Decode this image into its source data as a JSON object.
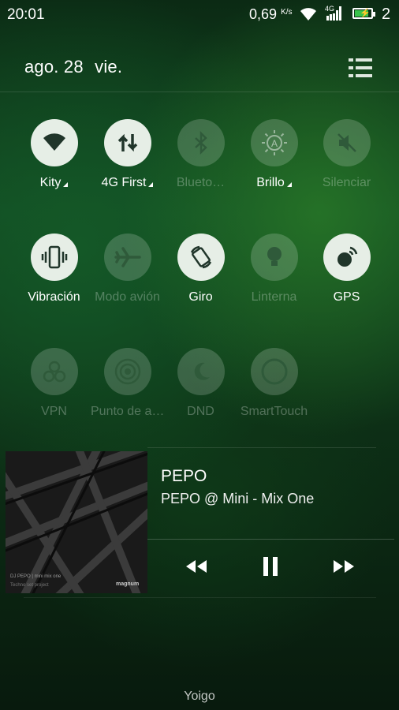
{
  "status_bar": {
    "time": "20:01",
    "speed_value": "0,69",
    "speed_unit": "K/s",
    "network": "4G",
    "notification_count": "2",
    "battery_level_percent": 85,
    "battery_color": "#39c24a"
  },
  "header": {
    "month_day": "ago. 28",
    "weekday": "vie.",
    "menu_icon": "list-icon"
  },
  "toggles": [
    {
      "label": "Kity",
      "icon": "wifi-icon",
      "state": "on",
      "expandable": true
    },
    {
      "label": "4G First",
      "icon": "data-arrows-icon",
      "state": "on",
      "expandable": true
    },
    {
      "label": "Blueto…",
      "icon": "bluetooth-icon",
      "state": "off",
      "expandable": false
    },
    {
      "label": "Brillo",
      "icon": "brightness-auto-icon",
      "state": "dim",
      "expandable": true
    },
    {
      "label": "Silenciar",
      "icon": "mute-icon",
      "state": "off",
      "expandable": false
    },
    {
      "label": "Vibración",
      "icon": "vibration-icon",
      "state": "on",
      "expandable": false
    },
    {
      "label": "Modo avión",
      "icon": "airplane-icon",
      "state": "off",
      "expandable": false
    },
    {
      "label": "Giro",
      "icon": "rotate-icon",
      "state": "on",
      "expandable": false
    },
    {
      "label": "Linterna",
      "icon": "flashlight-icon",
      "state": "off",
      "expandable": false
    },
    {
      "label": "GPS",
      "icon": "gps-icon",
      "state": "on",
      "expandable": false
    },
    {
      "label": "VPN",
      "icon": "vpn-icon",
      "state": "off",
      "expandable": false
    },
    {
      "label": "Punto de a…",
      "icon": "hotspot-icon",
      "state": "off",
      "expandable": false
    },
    {
      "label": "DND",
      "icon": "moon-icon",
      "state": "off",
      "expandable": false
    },
    {
      "label": "SmartTouch",
      "icon": "smarttouch-icon",
      "state": "off",
      "expandable": false
    }
  ],
  "media": {
    "title": "PEPO",
    "subtitle": "PEPO @ Mini - Mix One",
    "album_caption_line1": "DJ PEPO | mini mix one",
    "album_caption_line2": "Techno set project",
    "album_brand": "magnum",
    "controls": [
      "rewind-icon",
      "pause-icon",
      "fast-forward-icon"
    ]
  },
  "carrier": "Yoigo"
}
